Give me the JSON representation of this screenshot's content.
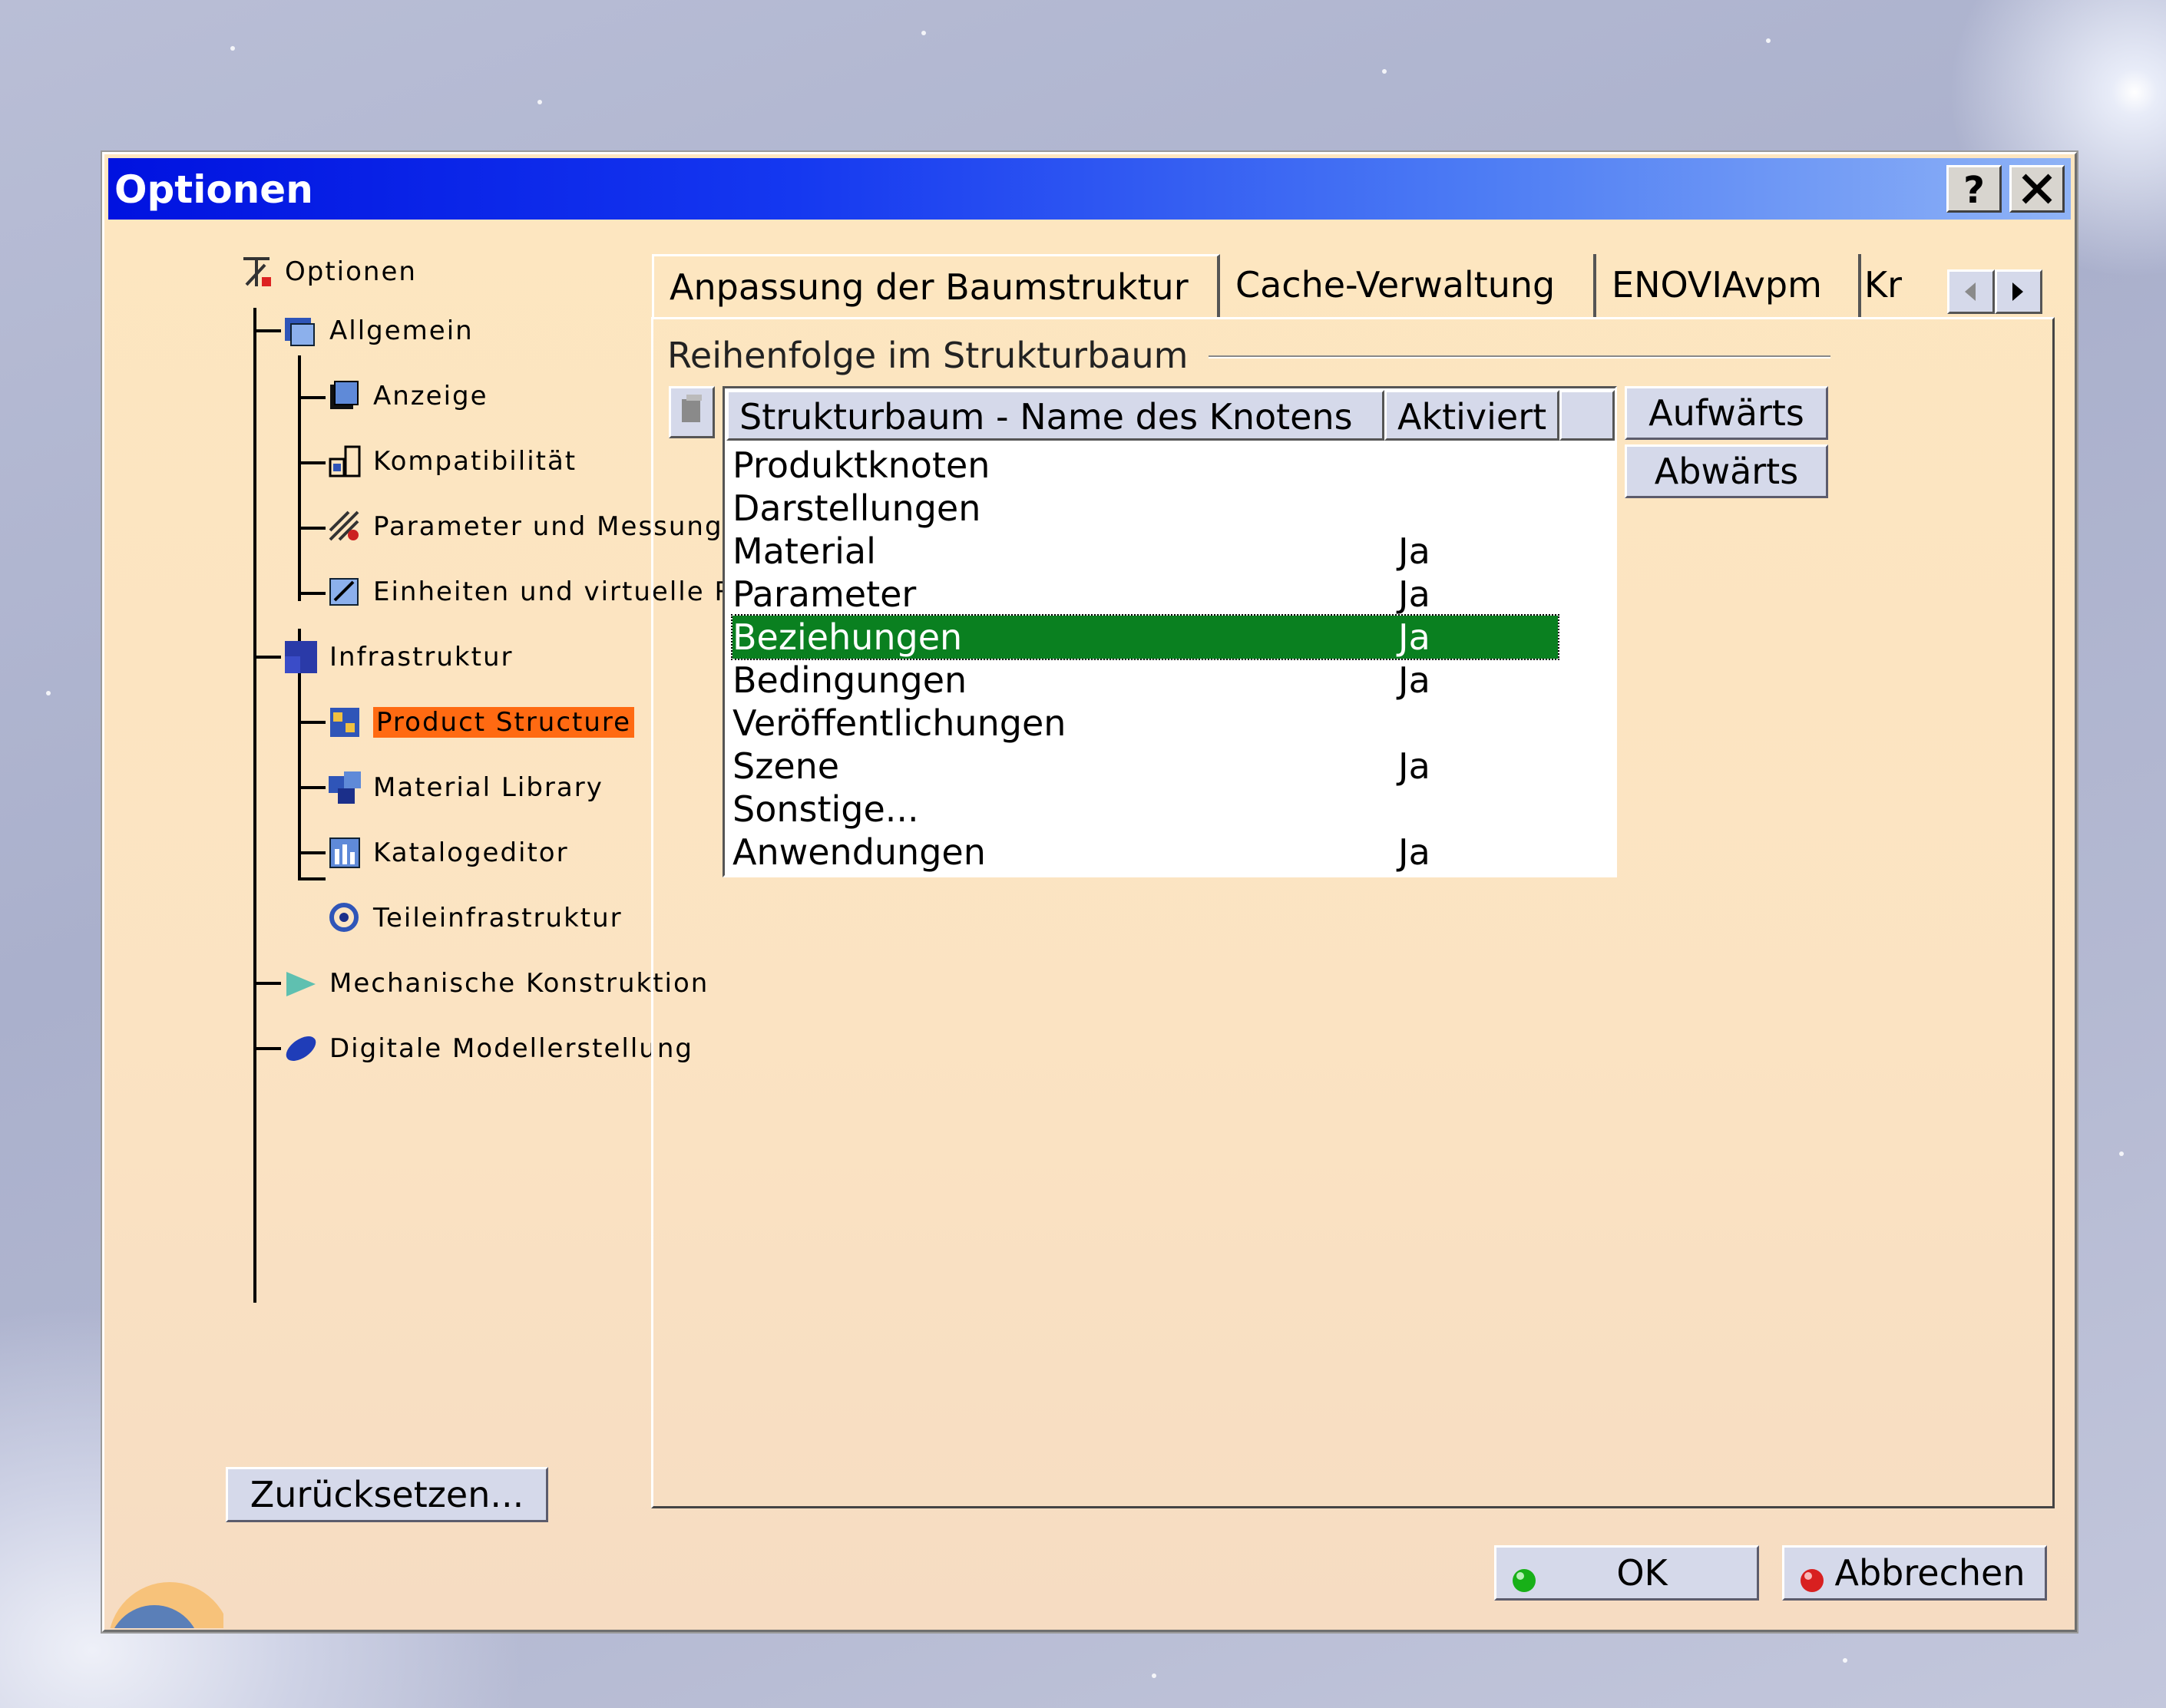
{
  "window": {
    "title": "Optionen",
    "help_label": "?",
    "close_label": "✕"
  },
  "tree": {
    "root": "Optionen",
    "allgemein": "Allgemein",
    "anzeige": "Anzeige",
    "kompatibilitaet": "Kompatibilität",
    "parameter": "Parameter und Messungen",
    "einheiten": "Einheiten und virtuelle Rea",
    "infrastruktur": "Infrastruktur",
    "product_structure": "Product Structure",
    "material_library": "Material Library",
    "katalogeditor": "Katalogeditor",
    "teileinfrastruktur": "Teileinfrastruktur",
    "mechanische": "Mechanische Konstruktion",
    "digitale": "Digitale Modellerstellung"
  },
  "reset_label": "Zurücksetzen...",
  "tabs": [
    "Anpassung der Baumstruktur",
    "Cache-Verwaltung",
    "ENOVIAvpm",
    "Kr"
  ],
  "group_label": "Reihenfolge im Strukturbaum",
  "table": {
    "headers": [
      "Strukturbaum - Name des Knotens",
      "Aktiviert"
    ],
    "rows": [
      {
        "name": "Produktknoten",
        "active": ""
      },
      {
        "name": "Darstellungen",
        "active": ""
      },
      {
        "name": "Material",
        "active": "Ja"
      },
      {
        "name": "Parameter",
        "active": "Ja"
      },
      {
        "name": "Beziehungen",
        "active": "Ja",
        "selected": true
      },
      {
        "name": "Bedingungen",
        "active": "Ja"
      },
      {
        "name": "Veröffentlichungen",
        "active": ""
      },
      {
        "name": "Szene",
        "active": "Ja"
      },
      {
        "name": "Sonstige...",
        "active": ""
      },
      {
        "name": "Anwendungen",
        "active": "Ja"
      }
    ]
  },
  "side_buttons": {
    "up": "Aufwärts",
    "down": "Abwärts"
  },
  "footer": {
    "ok": "OK",
    "cancel": "Abbrechen"
  },
  "colors": {
    "title_start": "#0012e0",
    "title_end": "#8fb3f6",
    "selection": "#0a8020",
    "tree_selection": "#ff6a12",
    "dialog_bg": "#fde6c0"
  }
}
